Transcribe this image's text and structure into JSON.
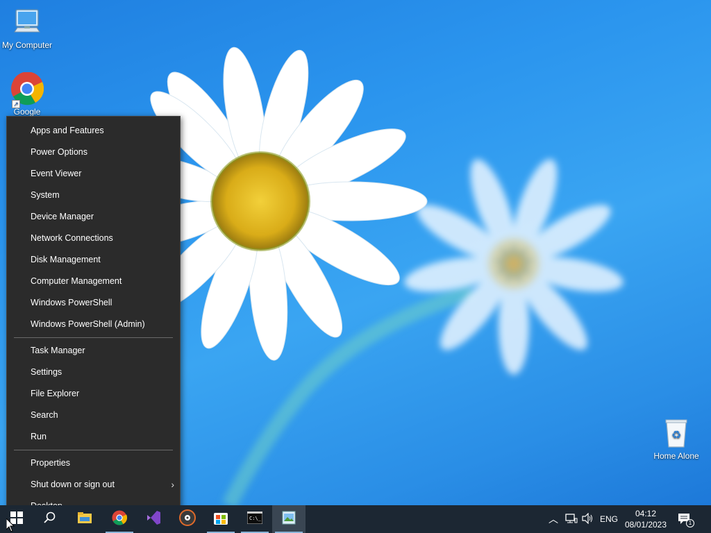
{
  "desktop": {
    "icons": [
      {
        "label": "My Computer"
      },
      {
        "label": "Google"
      },
      {
        "label": "Home Alone"
      }
    ]
  },
  "winx_menu": {
    "group1": [
      "Apps and Features",
      "Power Options",
      "Event Viewer",
      "System",
      "Device Manager",
      "Network Connections",
      "Disk Management",
      "Computer Management",
      "Windows PowerShell",
      "Windows PowerShell (Admin)"
    ],
    "group2": [
      "Task Manager",
      "Settings",
      "File Explorer",
      "Search",
      "Run"
    ],
    "group3": [
      "Properties",
      "Shut down or sign out",
      "Desktop"
    ]
  },
  "taskbar": {
    "pinned": [
      "start",
      "search",
      "file-explorer",
      "chrome",
      "visual-studio",
      "media-app",
      "store",
      "command-prompt",
      "image-viewer"
    ],
    "tray": {
      "language": "ENG",
      "time": "04:12",
      "date": "08/01/2023",
      "notification_count": "1"
    }
  },
  "colors": {
    "menu_bg": "#2b2b2b",
    "taskbar_bg": "#1c2733",
    "wallpaper_blue": "#2b95ee"
  }
}
